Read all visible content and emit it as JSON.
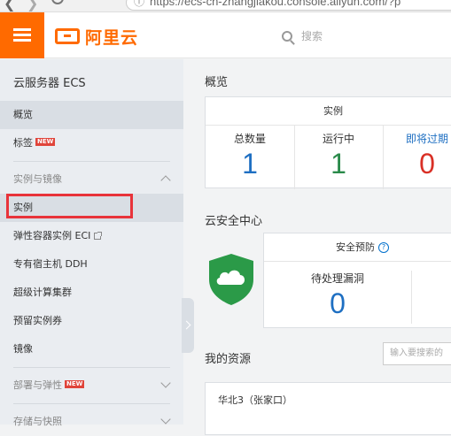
{
  "browser": {
    "url": "https://ecs-cn-zhangjiakou.console.aliyun.com/?p"
  },
  "topbar": {
    "logo_text": "阿里云",
    "search_placeholder": "搜索"
  },
  "sidebar": {
    "title": "云服务器 ECS",
    "overview": "概览",
    "tags": "标签",
    "new_badge": "NEW",
    "group_instances": "实例与镜像",
    "instances": "实例",
    "eci": "弹性容器实例 ECI",
    "ddh": "专有宿主机 DDH",
    "supercomputing": "超级计算集群",
    "reserved": "预留实例券",
    "images": "镜像",
    "group_deploy": "部署与弹性",
    "group_storage": "存储与快照"
  },
  "main": {
    "overview_title": "概览",
    "instances_card": {
      "header": "实例",
      "total_label": "总数量",
      "total_value": "1",
      "running_label": "运行中",
      "running_value": "1",
      "expiring_label": "即将过期",
      "expiring_value": "0"
    },
    "security_title": "云安全中心",
    "security_card": {
      "header": "安全预防",
      "pending_label": "待处理漏洞",
      "pending_value": "0"
    },
    "resources_title": "我的资源",
    "resources_search_placeholder": "输入要搜索的",
    "region_label": "华北3（张家口）"
  },
  "colors": {
    "brand": "#ff6a00",
    "blue": "#1e6fc2",
    "green": "#2a8a4a",
    "red": "#d93026",
    "shield": "#2b9a48",
    "highlight": "#e8333a"
  }
}
